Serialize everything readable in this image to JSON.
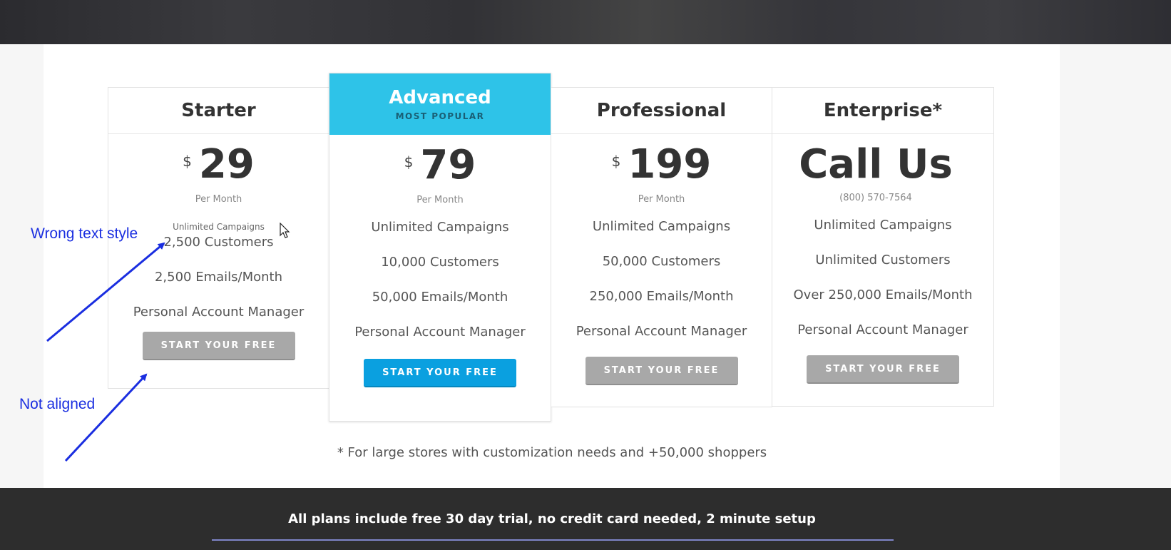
{
  "pricing": {
    "plans": [
      {
        "name": "Starter",
        "badge": "",
        "currency": "$",
        "amount": "29",
        "period": "Per Month",
        "features": [
          "Unlimited Campaigns",
          "2,500 Customers",
          "2,500 Emails/Month",
          "Personal Account Manager"
        ],
        "cta": "START YOUR FREE TRIAL"
      },
      {
        "name": "Advanced",
        "badge": "MOST POPULAR",
        "currency": "$",
        "amount": "79",
        "period": "Per Month",
        "features": [
          "Unlimited Campaigns",
          "10,000 Customers",
          "50,000 Emails/Month",
          "Personal Account Manager"
        ],
        "cta": "START YOUR FREE TRIAL"
      },
      {
        "name": "Professional",
        "badge": "",
        "currency": "$",
        "amount": "199",
        "period": "Per Month",
        "features": [
          "Unlimited Campaigns",
          "50,000 Customers",
          "250,000 Emails/Month",
          "Personal Account Manager"
        ],
        "cta": "START YOUR FREE TRIAL"
      },
      {
        "name": "Enterprise*",
        "badge": "",
        "currency": "",
        "amount": "Call Us",
        "period": "(800) 570-7564",
        "features": [
          "Unlimited Campaigns",
          "Unlimited Customers",
          "Over 250,000 Emails/Month",
          "Personal Account Manager"
        ],
        "cta": "START YOUR FREE TRIAL"
      }
    ],
    "footnote": "* For large stores with customization needs and +50,000 shoppers"
  },
  "footer": {
    "text": "All plans include free 30 day trial, no credit card needed, 2 minute setup"
  },
  "annotations": {
    "wrong_text_style": "Wrong text style",
    "not_aligned": "Not aligned"
  },
  "colors": {
    "featured_header": "#2ec3e8",
    "primary_button": "#0aa0e0",
    "secondary_button": "#a8a8a8",
    "annotation": "#1a2ee0",
    "footer_background": "#2d2d2d",
    "footer_rule": "#7f85c9"
  }
}
